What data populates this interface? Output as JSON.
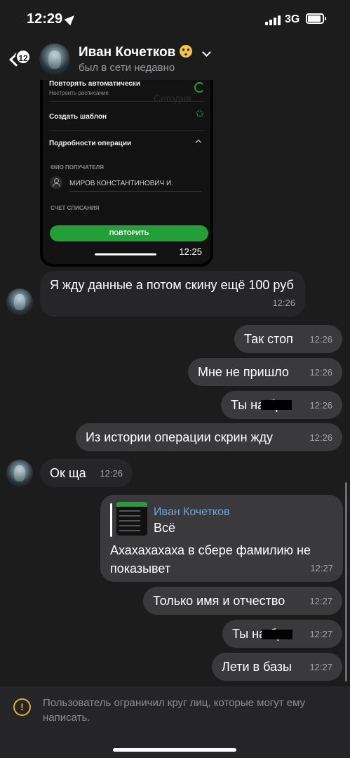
{
  "status_bar": {
    "time": "12:29",
    "network": "3G"
  },
  "header": {
    "unread_count": "12",
    "contact_name": "Иван Кочетков",
    "last_seen": "был в сети недавно"
  },
  "screenshot_message": {
    "row_auto": "Повторять автоматически",
    "row_auto_sub": "Настроить расписание",
    "ghost_text": "Сегодня",
    "row_template": "Создать шаблон",
    "row_details": "Подробности операции",
    "recipient_caption": "ФИО ПОЛУЧАТЕЛЯ",
    "recipient_name": "МИРОВ КОНСТАНТИНОВИЧ И.",
    "account_caption": "СЧЕТ СПИСАНИЯ",
    "repeat_button": "ПОВТОРИТЬ",
    "time": "12:25"
  },
  "messages": [
    {
      "text": "Я жду данные а потом скину ещё 100 руб",
      "time": "12:26"
    },
    {
      "text": "Так стоп",
      "time": "12:26"
    },
    {
      "text": "Мне не пришло",
      "time": "12:26"
    },
    {
      "text": "Ты на    бр",
      "time": "12:26"
    },
    {
      "text": "Из истории операции скрин жду",
      "time": "12:26"
    },
    {
      "text": "Ок ща",
      "time": "12:26"
    },
    {
      "reply_to_name": "Иван Кочетков",
      "reply_to_text": "Всё",
      "text": "Ахахахахаха в сбере фамилию не показывет",
      "time": "12:27"
    },
    {
      "text": "Только имя и отчество",
      "time": "12:27"
    },
    {
      "text": "Ты на    бр",
      "time": "12:27"
    },
    {
      "text": "Лети в базы",
      "time": "12:27"
    }
  ],
  "footer": {
    "icon": "warning-icon",
    "notice": "Пользователь ограничил круг лиц, которые могут ему написать."
  },
  "colors": {
    "background": "#1c1c1d",
    "incoming": "#262628",
    "outgoing": "#3a3a3c",
    "sber_green": "#21a038",
    "reply_name": "#6aa8e8",
    "warning": "#e3a93a"
  }
}
